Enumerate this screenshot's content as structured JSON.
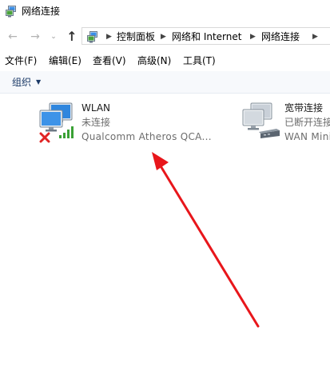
{
  "window": {
    "title": "网络连接",
    "icon": "network-connections-icon"
  },
  "navigation": {
    "back_icon": "arrow-left-icon",
    "forward_icon": "arrow-right-icon",
    "recent_icon": "chevron-down-icon",
    "up_icon": "arrow-up-icon",
    "breadcrumbs": [
      "控制面板",
      "网络和 Internet",
      "网络连接"
    ]
  },
  "menu": {
    "items": [
      "文件(F)",
      "编辑(E)",
      "查看(V)",
      "高级(N)",
      "工具(T)"
    ]
  },
  "commandbar": {
    "organize_label": "组织"
  },
  "connections": [
    {
      "name": "WLAN",
      "status": "未连接",
      "device": "Qualcomm Atheros QCA...",
      "icon": "wireless-adapter-icon",
      "overlay_icons": [
        "disconnected-x-icon",
        "signal-bars-icon"
      ]
    },
    {
      "name": "宽带连接",
      "status": "已断开连接",
      "device": "WAN Mini",
      "icon": "broadband-connection-icon",
      "overlay_icons": [
        "modem-icon"
      ]
    }
  ],
  "annotation": {
    "arrow_color": "#e8161b"
  }
}
